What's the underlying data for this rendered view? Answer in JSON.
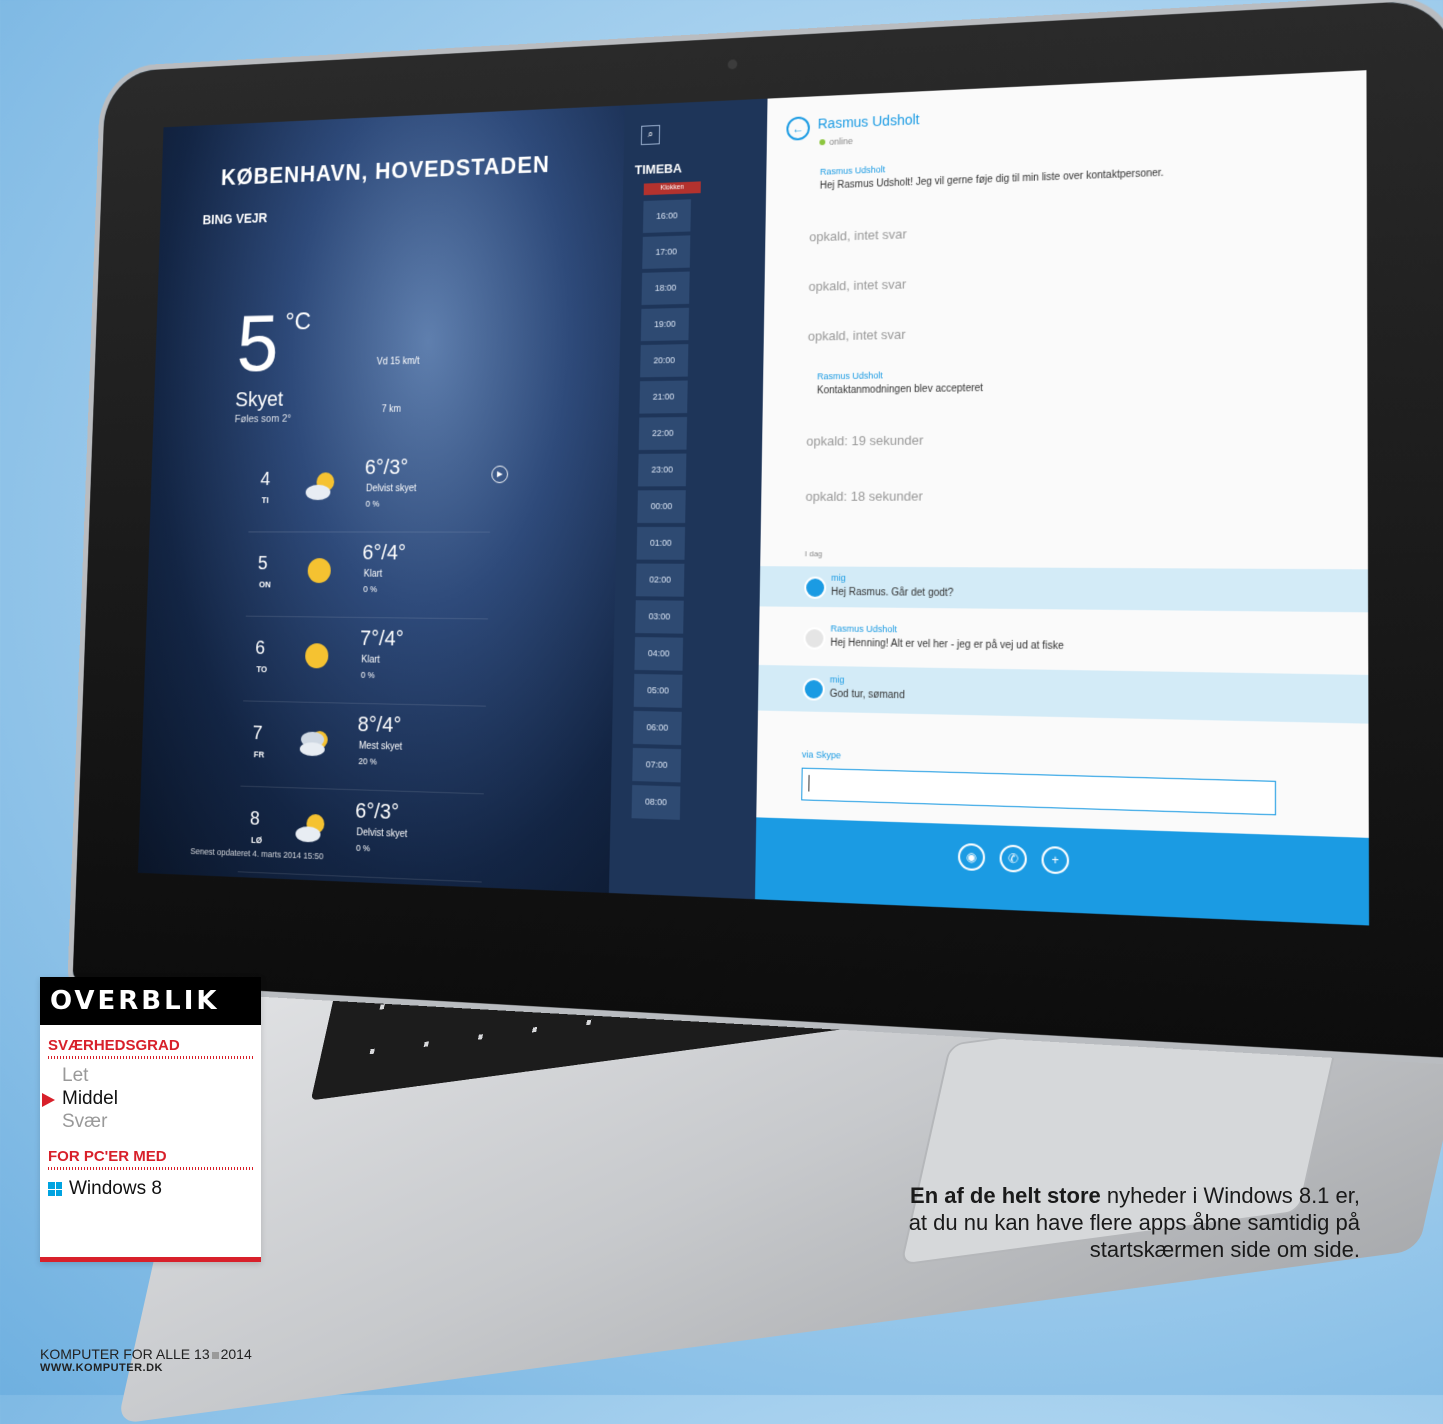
{
  "weather": {
    "city": "KØBENHAVN, HOVEDSTADEN",
    "app": "BING VEJR",
    "temp": "5",
    "unit": "°C",
    "condition": "Skyet",
    "feels": "Føles som 2°",
    "wind": "Vd 15 km/t",
    "visibility": "7 km",
    "forecast": [
      {
        "num": "4",
        "abbr": "TI",
        "temp": "6°/3°",
        "desc": "Delvist skyet",
        "rain": "0 %"
      },
      {
        "num": "5",
        "abbr": "ON",
        "temp": "6°/4°",
        "desc": "Klart",
        "rain": "0 %"
      },
      {
        "num": "6",
        "abbr": "TO",
        "temp": "7°/4°",
        "desc": "Klart",
        "rain": "0 %"
      },
      {
        "num": "7",
        "abbr": "FR",
        "temp": "8°/4°",
        "desc": "Mest skyet",
        "rain": "20 %"
      },
      {
        "num": "8",
        "abbr": "LØ",
        "temp": "6°/3°",
        "desc": "Delvist skyet",
        "rain": "0 %"
      }
    ],
    "updated": "Senest opdateret 4. marts 2014 15:50"
  },
  "timetable": {
    "title": "TIMEBA",
    "tab": "Klokken",
    "hours": [
      "16:00",
      "17:00",
      "18:00",
      "19:00",
      "20:00",
      "21:00",
      "22:00",
      "23:00",
      "00:00",
      "01:00",
      "02:00",
      "03:00",
      "04:00",
      "05:00",
      "06:00",
      "07:00",
      "08:00"
    ]
  },
  "chat": {
    "contact": "Rasmus Udsholt",
    "status": "online",
    "first_sender": "Rasmus Udsholt",
    "first_msg": "Hej Rasmus Udsholt! Jeg vil gerne føje dig til min liste over kontaktpersoner.",
    "calls": [
      "opkald, intet svar",
      "opkald, intet svar",
      "opkald, intet svar"
    ],
    "accept_sender": "Rasmus Udsholt",
    "accept_msg": "Kontaktanmodningen blev accepteret",
    "calls2": [
      "opkald: 19 sekunder",
      "opkald: 18 sekunder"
    ],
    "date": "I dag",
    "me1_sender": "mig",
    "me1_msg": "Hej Rasmus. Går det godt?",
    "r_sender": "Rasmus Udsholt",
    "r_msg": "Hej Henning! Alt er vel her - jeg er på vej ud at fiske",
    "me2_sender": "mig",
    "me2_msg": "God tur, sømand",
    "typing": "via Skype"
  },
  "overview": {
    "heading": "OVERBLIK",
    "difficulty_label": "SVÆRHEDSGRAD",
    "levels": [
      "Let",
      "Middel",
      "Svær"
    ],
    "platform_label": "FOR PC'ER MED",
    "platform": "Windows 8"
  },
  "caption": {
    "lead": "En af de helt store",
    "rest": " nyheder i Windows 8.1 er, at du nu kan have flere apps åbne samtidig på startskærmen side om side."
  },
  "footer": {
    "magazine_a": "KOMPUTER FOR ALLE 13",
    "magazine_b": "2014",
    "url": "WWW.KOMPUTER.DK"
  },
  "colors": {
    "accent": "#d8202a",
    "skype": "#1b9be3",
    "windows": "#00a3e0"
  }
}
